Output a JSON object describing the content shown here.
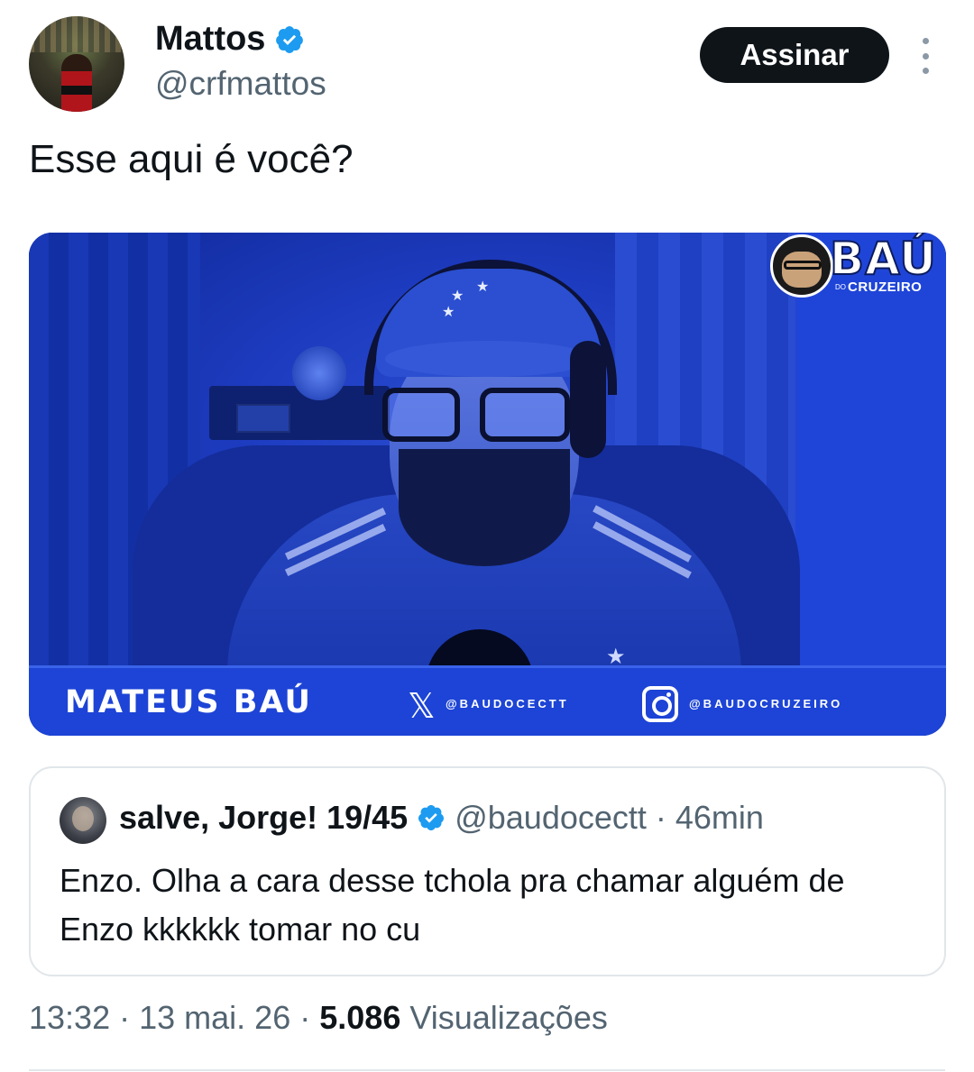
{
  "author": {
    "name": "Mattos",
    "handle": "@crfmattos",
    "verified": true
  },
  "actions": {
    "subscribe_label": "Assinar",
    "more_icon": "more-vertical-icon"
  },
  "tweet": {
    "text": "Esse aqui é você?"
  },
  "media": {
    "logo_text": "BAÚ",
    "logo_do": "DO",
    "logo_sub": "CRUZEIRO",
    "lower_third_name": "MATEUS BAÚ",
    "x_handle": "@BAUDOCECTT",
    "instagram_handle": "@BAUDOCRUZEIRO"
  },
  "quoted_tweet": {
    "name": "salve, Jorge! 19/45",
    "handle": "@baudocectt",
    "separator": "·",
    "time": "46min",
    "text": "Enzo. Olha a cara desse tchola pra chamar alguém de Enzo kkkkkk tomar no cu"
  },
  "meta": {
    "time": "13:32",
    "separator": "·",
    "date": "13 mai. 26",
    "views_count": "5.086",
    "views_label": "Visualizações"
  },
  "colors": {
    "verified_blue": "#1d9bf0",
    "text_primary": "#0f1419",
    "text_secondary": "#536471",
    "button_bg": "#0f1419"
  }
}
